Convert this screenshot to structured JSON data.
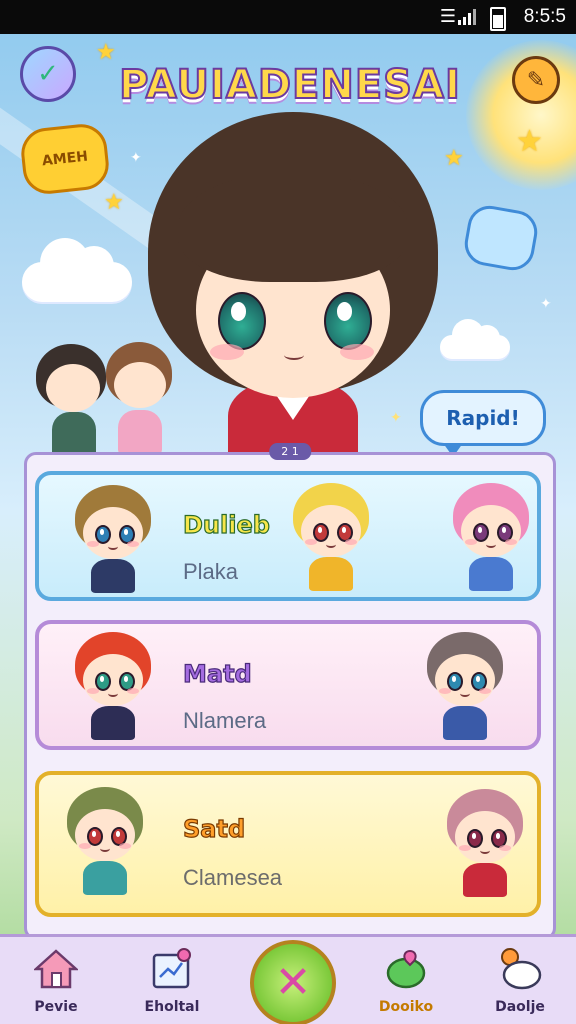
{
  "status_bar": {
    "time": "8:5:5"
  },
  "header": {
    "title": "PAUIADENESAI",
    "badge_text": "AMEH",
    "speech_bubble": "Rapid!"
  },
  "panel": {
    "badge": "2 1",
    "cards": [
      {
        "title": "Dulieb",
        "subtitle": "Plaka"
      },
      {
        "title": "Matd",
        "subtitle": "Nlamera"
      },
      {
        "title": "Satd",
        "subtitle": "Clamesea"
      }
    ]
  },
  "bottom_nav": {
    "items": [
      {
        "label": "Pevie",
        "icon": "house-icon"
      },
      {
        "label": "Eholtal",
        "icon": "clipboard-icon"
      },
      {
        "label": "",
        "icon": "close-icon"
      },
      {
        "label": "Dooiko",
        "icon": "leaf-heart-icon"
      },
      {
        "label": "Daolje",
        "icon": "speech-cloud-icon"
      }
    ]
  },
  "colors": {
    "accent_purple": "#a792d6",
    "title_yellow": "#ffd84a",
    "active_nav": "#c47a00"
  }
}
